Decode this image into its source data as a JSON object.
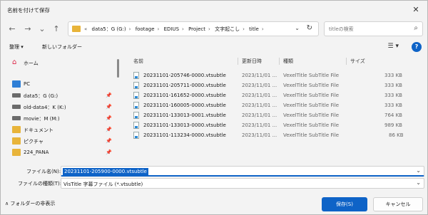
{
  "window": {
    "title": "名前を付けて保存",
    "close_glyph": "✕"
  },
  "nav": {
    "back_glyph": "←",
    "forward_glyph": "→",
    "dropdown_glyph": "⌄",
    "up_glyph": "↑",
    "breadcrumbs": [
      "data5：G (G:)",
      "footage",
      "EDIUS",
      "Project",
      "文字起こし",
      "title"
    ],
    "overflow": "«",
    "refresh_glyph": "↻",
    "search_placeholder": "titleの検索"
  },
  "toolbar": {
    "organize": "整理 ▾",
    "new_folder": "新しいフォルダー",
    "view_glyph": "☰ ▾",
    "help_glyph": "?"
  },
  "sidebar": {
    "items": [
      {
        "label": "ホーム",
        "icon": "home-icon",
        "pinned": false
      },
      {
        "label": "PC",
        "icon": "pc-icon",
        "pinned": false
      },
      {
        "label": "data5：G (G:)",
        "icon": "drive-icon",
        "pinned": true
      },
      {
        "label": "old-data4：K (K:)",
        "icon": "drive-icon",
        "pinned": true
      },
      {
        "label": "movie：M (M:)",
        "icon": "drive-icon",
        "pinned": true
      },
      {
        "label": "ドキュメント",
        "icon": "folder-icon",
        "pinned": true
      },
      {
        "label": "ピクチャ",
        "icon": "folder-icon",
        "pinned": true
      },
      {
        "label": "224_PANA",
        "icon": "folder-icon",
        "pinned": true
      }
    ],
    "pin_glyph": "📌"
  },
  "files": {
    "headers": {
      "name": "名前",
      "date": "更新日時",
      "type": "種類",
      "size": "サイズ"
    },
    "rows": [
      {
        "name": "20231101-205746-0000.vtsubtle",
        "date": "2023/11/01 ...",
        "type": "VexelTitle SubTitle File",
        "size": "333 KB"
      },
      {
        "name": "20231101-205711-0000.vtsubtle",
        "date": "2023/11/01 ...",
        "type": "VexelTitle SubTitle File",
        "size": "333 KB"
      },
      {
        "name": "20231101-161652-0000.vtsubtle",
        "date": "2023/11/01 ...",
        "type": "VexelTitle SubTitle File",
        "size": "333 KB"
      },
      {
        "name": "20231101-160005-0000.vtsubtle",
        "date": "2023/11/01 ...",
        "type": "VexelTitle SubTitle File",
        "size": "333 KB"
      },
      {
        "name": "20231101-133013-0001.vtsubtle",
        "date": "2023/11/01 ...",
        "type": "VexelTitle SubTitle File",
        "size": "764 KB"
      },
      {
        "name": "20231101-133013-0000.vtsubtle",
        "date": "2023/11/01 ...",
        "type": "VexelTitle SubTitle File",
        "size": "989 KB"
      },
      {
        "name": "20231101-113234-0000.vtsubtle",
        "date": "2023/11/01 ...",
        "type": "VexelTitle SubTitle File",
        "size": "86 KB"
      }
    ]
  },
  "bottom": {
    "filename_label": "ファイル名(N):",
    "filename_value": "20231101-205900-0000.vtsubtle",
    "filetype_label": "ファイルの種類(T):",
    "filetype_value": "VisTitle 字幕ファイル (*.vtsubtle)",
    "dropdown_glyph": "⌄",
    "hide_folders": "∧  フォルダーの非表示",
    "save": "保存(S)",
    "cancel": "キャンセル"
  }
}
